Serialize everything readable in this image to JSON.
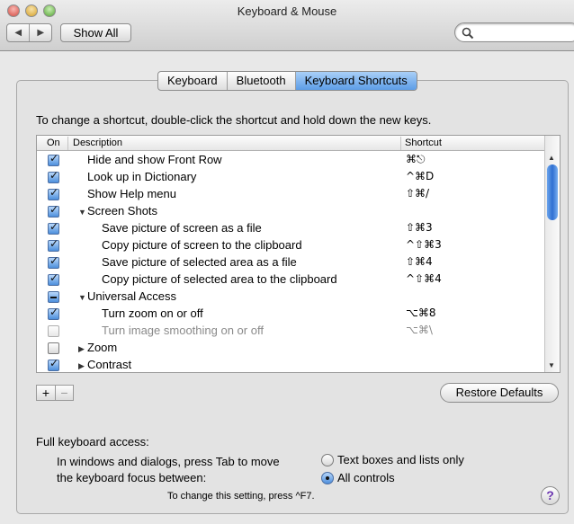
{
  "window": {
    "title": "Keyboard & Mouse"
  },
  "toolbar": {
    "back": "◀",
    "forward": "▶",
    "show_all": "Show All",
    "search_placeholder": ""
  },
  "tabs": [
    {
      "label": "Keyboard",
      "active": false
    },
    {
      "label": "Bluetooth",
      "active": false
    },
    {
      "label": "Keyboard Shortcuts",
      "active": true
    }
  ],
  "instructions": "To change a shortcut, double-click the shortcut and hold down the new keys.",
  "table": {
    "headers": {
      "on": "On",
      "description": "Description",
      "shortcut": "Shortcut"
    },
    "rows": [
      {
        "state": "checked",
        "indent": 1,
        "triangle": "",
        "description": "Hide and show Front Row",
        "shortcut": "⌘⎋"
      },
      {
        "state": "checked",
        "indent": 1,
        "triangle": "",
        "description": "Look up in Dictionary",
        "shortcut": "^⌘D"
      },
      {
        "state": "checked",
        "indent": 1,
        "triangle": "",
        "description": "Show Help menu",
        "shortcut": "⇧⌘/"
      },
      {
        "state": "checked",
        "indent": 0,
        "triangle": "▼",
        "description": "Screen Shots",
        "shortcut": ""
      },
      {
        "state": "checked",
        "indent": 2,
        "triangle": "",
        "description": "Save picture of screen as a file",
        "shortcut": "⇧⌘3"
      },
      {
        "state": "checked",
        "indent": 2,
        "triangle": "",
        "description": "Copy picture of screen to the clipboard",
        "shortcut": "^⇧⌘3"
      },
      {
        "state": "checked",
        "indent": 2,
        "triangle": "",
        "description": "Save picture of selected area as a file",
        "shortcut": "⇧⌘4"
      },
      {
        "state": "checked",
        "indent": 2,
        "triangle": "",
        "description": "Copy picture of selected area to the clipboard",
        "shortcut": "^⇧⌘4"
      },
      {
        "state": "mixed",
        "indent": 0,
        "triangle": "▼",
        "description": "Universal Access",
        "shortcut": ""
      },
      {
        "state": "checked",
        "indent": 2,
        "triangle": "",
        "description": "Turn zoom on or off",
        "shortcut": "⌥⌘8"
      },
      {
        "state": "unchecked-dim",
        "indent": 2,
        "triangle": "",
        "description": "Turn image smoothing on or off",
        "shortcut": "⌥⌘\\"
      },
      {
        "state": "unchecked",
        "indent": 1,
        "triangle": "▶",
        "description": "Zoom",
        "shortcut": ""
      },
      {
        "state": "checked",
        "indent": 1,
        "triangle": "▶",
        "description": "Contrast",
        "shortcut": ""
      }
    ]
  },
  "buttons": {
    "add": "+",
    "remove": "−",
    "restore_defaults": "Restore Defaults",
    "help": "?"
  },
  "full_keyboard_access": {
    "label": "Full keyboard access:",
    "description_line1": "In windows and dialogs, press Tab to move",
    "description_line2": "the keyboard focus between:",
    "options": [
      {
        "label": "Text boxes and lists only",
        "selected": false
      },
      {
        "label": "All controls",
        "selected": true
      }
    ],
    "hint": "To change this setting, press ^F7."
  }
}
